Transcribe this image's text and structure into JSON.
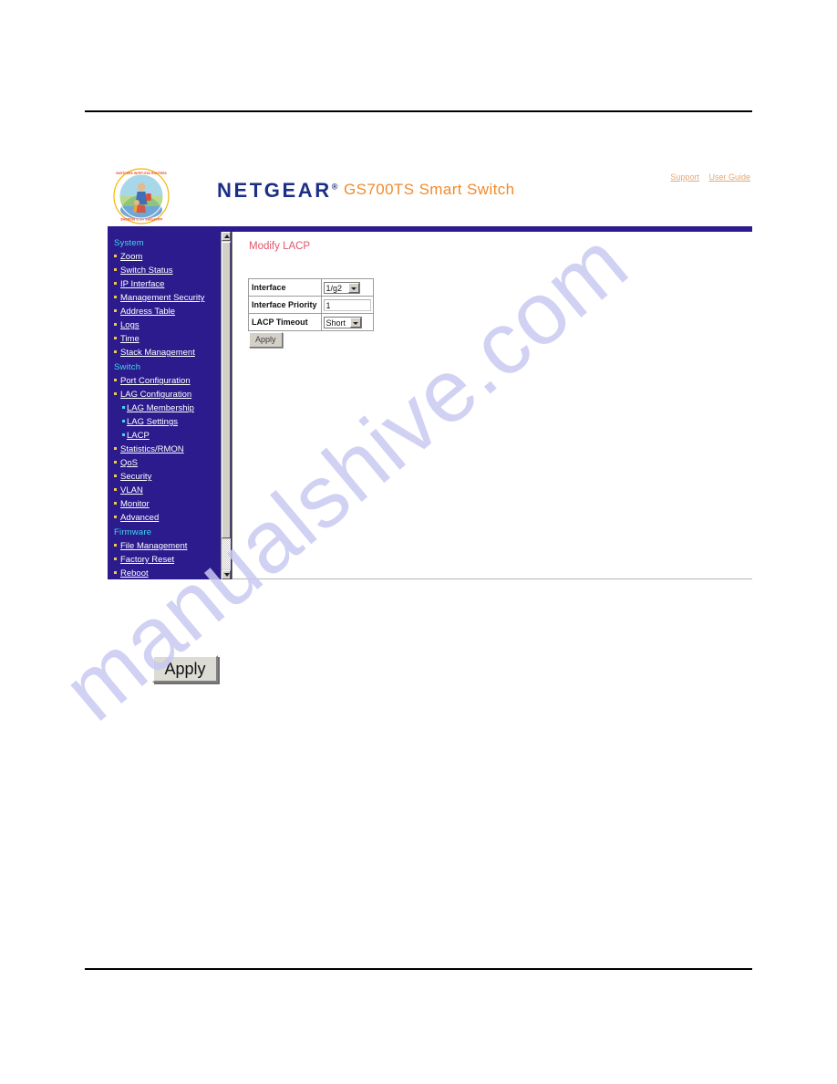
{
  "header": {
    "brand": "NETGEAR",
    "brand_tm": "®",
    "product": "GS700TS Smart Switch",
    "links": [
      {
        "label": "Support",
        "name": "support-link"
      },
      {
        "label": "User Guide",
        "name": "user-guide-link"
      }
    ],
    "logo_alt": "netgear-badge-logo",
    "brand_color": "#1b2f86",
    "product_color": "#f08b2e",
    "link_color": "#e3a877",
    "bar_color": "#2b1b8c"
  },
  "sidebar": {
    "background": "#2b1b8c",
    "section_color": "#41d8f0",
    "link_color": "#ffffff",
    "groups": [
      {
        "section": "System",
        "items": [
          {
            "label": "Zoom",
            "sub": false
          },
          {
            "label": "Switch Status",
            "sub": false
          },
          {
            "label": "IP Interface",
            "sub": false
          },
          {
            "label": "Management Security",
            "sub": false
          },
          {
            "label": "Address Table",
            "sub": false
          },
          {
            "label": "Logs",
            "sub": false
          },
          {
            "label": "Time",
            "sub": false
          },
          {
            "label": "Stack Management",
            "sub": false
          }
        ]
      },
      {
        "section": "Switch",
        "items": [
          {
            "label": "Port Configuration",
            "sub": false
          },
          {
            "label": "LAG Configuration",
            "sub": false
          },
          {
            "label": "LAG Membership",
            "sub": true
          },
          {
            "label": "LAG Settings",
            "sub": true
          },
          {
            "label": "LACP",
            "sub": true
          },
          {
            "label": "Statistics/RMON",
            "sub": false
          },
          {
            "label": "QoS",
            "sub": false
          },
          {
            "label": "Security",
            "sub": false
          },
          {
            "label": "VLAN",
            "sub": false
          },
          {
            "label": "Monitor",
            "sub": false
          },
          {
            "label": "Advanced",
            "sub": false
          }
        ]
      },
      {
        "section": "Firmware",
        "items": [
          {
            "label": "File Management",
            "sub": false
          },
          {
            "label": "Factory Reset",
            "sub": false
          },
          {
            "label": "Reboot",
            "sub": false
          }
        ]
      }
    ]
  },
  "content": {
    "title": "Modify LACP",
    "title_color": "#e0566a",
    "fields": [
      {
        "label": "Interface",
        "type": "select",
        "value": "1/g2"
      },
      {
        "label": "Interface Priority",
        "type": "text",
        "value": "1"
      },
      {
        "label": "LACP Timeout",
        "type": "select",
        "value": "Short"
      }
    ],
    "apply_label": "Apply"
  },
  "figure": {
    "apply_button_label": "Apply"
  },
  "watermark": {
    "text": "manualshive.com",
    "color": "#c9c9f2"
  }
}
